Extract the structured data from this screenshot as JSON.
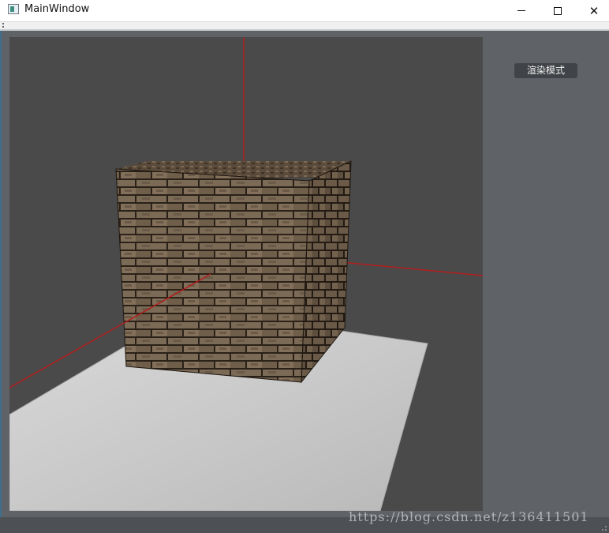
{
  "window": {
    "title": "MainWindow",
    "controls": {
      "minimize": "minimize",
      "maximize": "maximize",
      "close": "close"
    }
  },
  "viewport": {
    "scene": "textured brick cube on concrete floor with coordinate axes",
    "background_color": "#4a4a4a",
    "axis_color": "#b31d1d"
  },
  "side_panel": {
    "render_mode_button": "渲染模式"
  },
  "watermark": "https://blog.csdn.net/z136411501",
  "colors": {
    "panel_bg": "#5f6368",
    "button_bg": "#404347"
  }
}
